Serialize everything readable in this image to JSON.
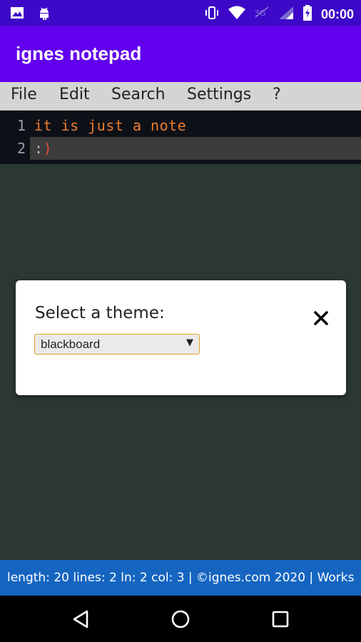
{
  "status_bar": {
    "time": "00:00",
    "icons": [
      "gallery-icon",
      "android-icon",
      "vibrate-icon",
      "wifi-icon",
      "signal-off-icon",
      "cell-signal-icon",
      "battery-charging-icon"
    ]
  },
  "app": {
    "title": "ignes notepad"
  },
  "menu": {
    "items": [
      "File",
      "Edit",
      "Search",
      "Settings",
      "?"
    ]
  },
  "editor": {
    "lines": [
      {
        "number": "1",
        "text": "it is just a note"
      },
      {
        "number": "2",
        "colon": ":",
        "paren": ")"
      }
    ]
  },
  "dialog": {
    "label": "Select a theme:",
    "selected_theme": "blackboard",
    "close_symbol": "×"
  },
  "footer": {
    "text": "length: 20 lines: 2 ln: 2 col: 3 | ©ignes.com 2020 | Works"
  },
  "nav": {
    "buttons": [
      "back-icon",
      "home-icon",
      "recents-icon"
    ]
  },
  "colors": {
    "app_bar": "#6200ee",
    "status_bar": "#3d08c7",
    "code_text": "#ef7c2e",
    "footer": "#1565c0",
    "background": "#2b3733"
  }
}
